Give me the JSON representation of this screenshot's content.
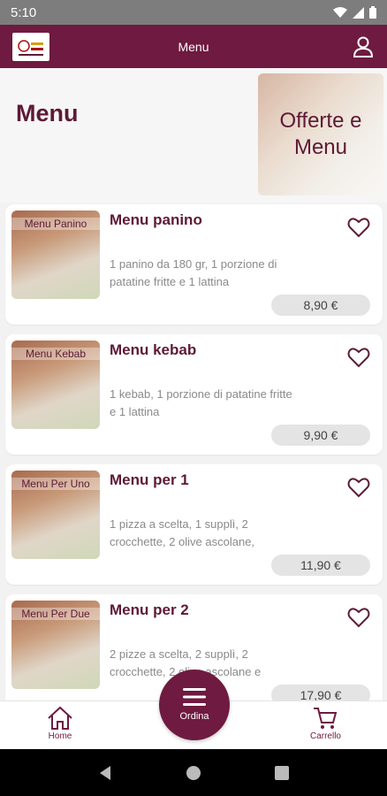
{
  "status_bar": {
    "time": "5:10"
  },
  "app_bar": {
    "title": "Menu",
    "logo_text": ""
  },
  "hero": {
    "title": "Menu",
    "image_text": "Offerte e Menu"
  },
  "items": [
    {
      "thumb_label": "Menu Panino",
      "title": "Menu panino",
      "desc": "1 panino da 180 gr, 1 porzione di patatine fritte e 1 lattina",
      "price": "8,90 €"
    },
    {
      "thumb_label": "Menu Kebab",
      "title": "Menu kebab",
      "desc": "1 kebab, 1 porzione di patatine fritte e 1 lattina",
      "price": "9,90 €"
    },
    {
      "thumb_label": "Menu Per Uno",
      "title": "Menu per 1",
      "desc": "1 pizza a scelta, 1 supplì, 2 crocchette, 2 olive ascolane,",
      "price": "11,90 €"
    },
    {
      "thumb_label": "Menu Per Due",
      "title": "Menu per 2",
      "desc": "2 pizze a scelta, 2 supplì, 2 crocchette, 2 olive ascolane e",
      "price": "17,90 €"
    }
  ],
  "bottom_nav": {
    "home": "Home",
    "cart": "Carrello",
    "order": "Ordina"
  },
  "colors": {
    "primary": "#6f1a40",
    "title": "#5e1a35",
    "price_bg": "#e4e4e4"
  }
}
